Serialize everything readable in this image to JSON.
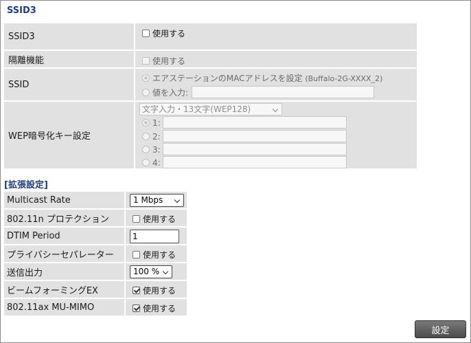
{
  "section_title": "SSID3",
  "ssid3_row": {
    "label": "SSID3",
    "checkbox_label": "使用する"
  },
  "isolation_row": {
    "label": "隔離機能",
    "checkbox_label": "使用する"
  },
  "ssid_row": {
    "label": "SSID",
    "option_mac": "エアステーションのMACアドレスを設定",
    "option_mac_hint": "(Buffalo-2G-XXXX_2)",
    "option_input": "値を入力:",
    "input_value": ""
  },
  "wep_row": {
    "label": "WEP暗号化キー設定",
    "type_select": "文字入力・13文字(WEP128)",
    "keys": [
      "1:",
      "2:",
      "3:",
      "4:"
    ]
  },
  "ext_title": "[拡張設定]",
  "ext": {
    "multicast_rate": {
      "label": "Multicast Rate",
      "value": "1 Mbps"
    },
    "protection": {
      "label": "802.11n プロテクション",
      "checkbox_label": "使用する",
      "checked": false
    },
    "dtim": {
      "label": "DTIM Period",
      "value": "1"
    },
    "privacy": {
      "label": "プライバシーセパレーター",
      "checkbox_label": "使用する",
      "checked": false
    },
    "tx_power": {
      "label": "送信出力",
      "value": "100 %"
    },
    "beamforming": {
      "label": "ビームフォーミングEX",
      "checkbox_label": "使用する",
      "checked": true
    },
    "mu_mimo": {
      "label": "802.11ax MU-MIMO",
      "checkbox_label": "使用する",
      "checked": true
    }
  },
  "submit_label": "設定"
}
